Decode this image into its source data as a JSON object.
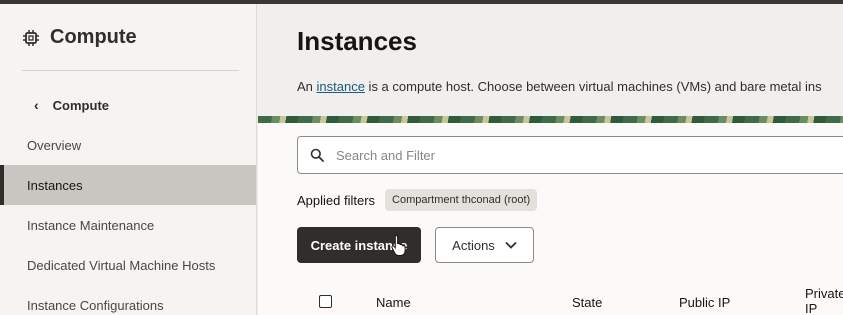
{
  "sidebar": {
    "title": "Compute",
    "title_icon": "chip-icon",
    "back_label": "Compute",
    "back_icon": "chevron-left-icon",
    "items": [
      {
        "label": "Overview",
        "active": false
      },
      {
        "label": "Instances",
        "active": true
      },
      {
        "label": "Instance Maintenance",
        "active": false
      },
      {
        "label": "Dedicated Virtual Machine Hosts",
        "active": false
      },
      {
        "label": "Instance Configurations",
        "active": false
      }
    ]
  },
  "main": {
    "title": "Instances",
    "description": {
      "prefix": "An ",
      "link": "instance",
      "suffix": " is a compute host. Choose between virtual machines (VMs) and bare metal ins"
    },
    "search": {
      "placeholder": "Search and Filter",
      "icon": "search-icon"
    },
    "filters": {
      "label": "Applied filters",
      "chip": "Compartment thconad (root)"
    },
    "buttons": {
      "create": "Create instance",
      "actions": "Actions",
      "actions_icon": "chevron-down-icon"
    },
    "table": {
      "columns": [
        "Name",
        "State",
        "Public IP",
        "Private\nIP"
      ]
    }
  },
  "colors": {
    "primary_button": "#312d2a",
    "active_nav": "#c9c6c2",
    "link": "#1a5a7a"
  }
}
